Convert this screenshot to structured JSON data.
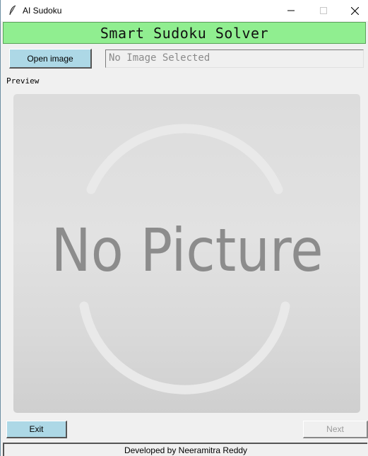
{
  "window": {
    "title": "AI Sudoku",
    "icon": "feather-icon"
  },
  "header": {
    "title": "Smart Sudoku Solver",
    "background": "#90ee90"
  },
  "toolbar": {
    "open_label": "Open image",
    "file_path_value": "No Image Selected"
  },
  "preview": {
    "label": "Preview",
    "placeholder_text": "No Picture"
  },
  "footer_buttons": {
    "exit_label": "Exit",
    "next_label": "Next"
  },
  "footer": {
    "credit": "Developed by Neeramitra Reddy"
  },
  "colors": {
    "button_accent": "#add8e6",
    "banner": "#90ee90"
  }
}
